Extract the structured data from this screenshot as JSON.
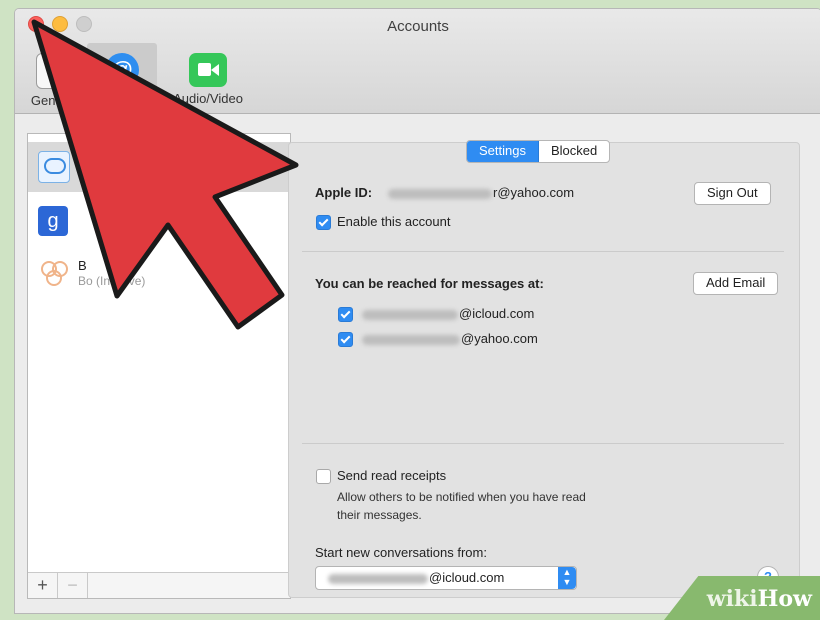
{
  "window": {
    "title": "Accounts"
  },
  "toolbar": {
    "items": [
      {
        "label": "General"
      },
      {
        "label": "Accounts"
      },
      {
        "label": "Audio/Video"
      }
    ]
  },
  "sidebar": {
    "accounts": [
      {
        "icon": "messages-icon",
        "name": "",
        "status": ""
      },
      {
        "icon": "google-icon",
        "letter": "g",
        "name": "",
        "status": ""
      },
      {
        "icon": "bonjour-icon",
        "name": "B",
        "status": "Bo (Inactive)"
      }
    ],
    "add_label": "+",
    "remove_label": "−"
  },
  "tabs": {
    "settings": "Settings",
    "blocked": "Blocked"
  },
  "settings": {
    "apple_id_label": "Apple ID:",
    "apple_id_value": "r@yahoo.com",
    "sign_out": "Sign Out",
    "enable_account": "Enable this account",
    "reach_label": "You can be reached for messages at:",
    "add_email": "Add Email",
    "addresses": [
      {
        "value": "@icloud.com",
        "checked": true
      },
      {
        "value": "@yahoo.com",
        "checked": true
      }
    ],
    "read_receipts": "Send read receipts",
    "read_receipts_desc_1": "Allow others to be notified when you have read",
    "read_receipts_desc_2": "their messages.",
    "start_from_label": "Start new conversations from:",
    "start_from_value": "@icloud.com",
    "help": "?"
  },
  "watermark": {
    "part1": "wiki",
    "part2": "How"
  },
  "colors": {
    "accent": "#2f8cf2",
    "arrow": "#e03a3e"
  }
}
